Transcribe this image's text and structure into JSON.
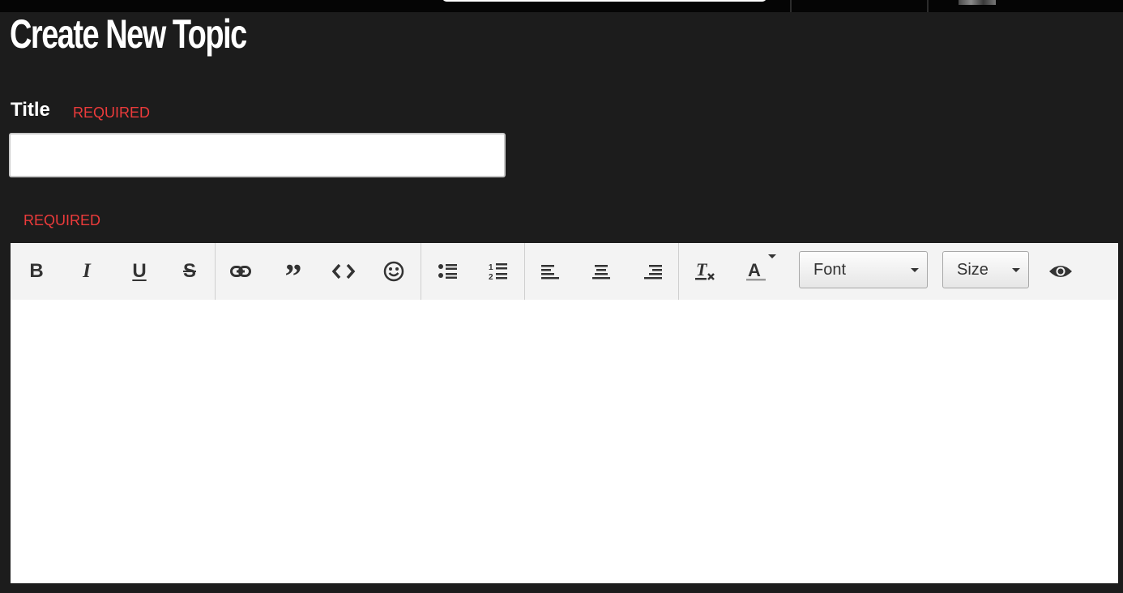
{
  "page": {
    "title": "Create New Topic"
  },
  "form": {
    "title_label": "Title",
    "title_required": "REQUIRED",
    "title_value": "",
    "title_placeholder": "",
    "body_required": "REQUIRED"
  },
  "toolbar": {
    "bold_label": "B",
    "italic_label": "I",
    "underline_label": "U",
    "strike_label": "S",
    "icons": [
      "bold-icon",
      "italic-icon",
      "underline-icon",
      "strikethrough-icon",
      "link-icon",
      "quote-icon",
      "code-icon",
      "emoji-icon",
      "bullet-list-icon",
      "numbered-list-icon",
      "align-left-icon",
      "align-center-icon",
      "align-right-icon",
      "clear-format-icon",
      "text-color-icon",
      "preview-icon"
    ],
    "font_select": "Font",
    "size_select": "Size"
  },
  "colors": {
    "background": "#1c1c1c",
    "required": "#ec3b3b",
    "toolbar": "#f3f3f3"
  }
}
